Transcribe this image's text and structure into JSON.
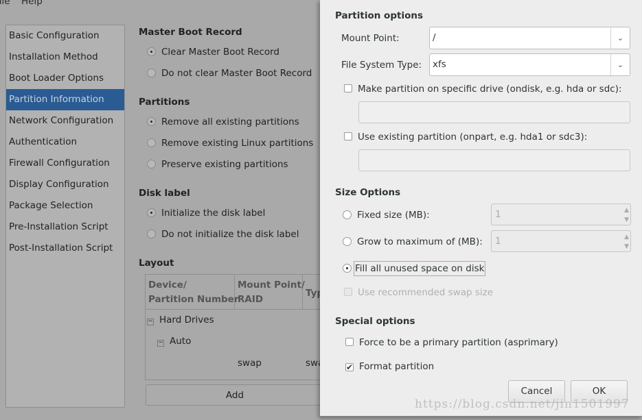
{
  "menu": {
    "file": "File",
    "help": "Help"
  },
  "sidebar": {
    "items": [
      {
        "label": "Basic Configuration"
      },
      {
        "label": "Installation Method"
      },
      {
        "label": "Boot Loader Options"
      },
      {
        "label": "Partition Information",
        "selected": true
      },
      {
        "label": "Network Configuration"
      },
      {
        "label": "Authentication"
      },
      {
        "label": "Firewall Configuration"
      },
      {
        "label": "Display Configuration"
      },
      {
        "label": "Package Selection"
      },
      {
        "label": "Pre-Installation Script"
      },
      {
        "label": "Post-Installation Script"
      }
    ]
  },
  "main": {
    "mbr": {
      "title": "Master Boot Record",
      "options": [
        {
          "label": "Clear Master Boot Record",
          "checked": true
        },
        {
          "label": "Do not clear Master Boot Record",
          "checked": false
        }
      ]
    },
    "partitions": {
      "title": "Partitions",
      "options": [
        {
          "label": "Remove all existing partitions",
          "checked": true
        },
        {
          "label": "Remove existing Linux partitions",
          "checked": false
        },
        {
          "label": "Preserve existing partitions",
          "checked": false
        }
      ]
    },
    "disk_label": {
      "title": "Disk label",
      "options": [
        {
          "label": "Initialize the disk label",
          "checked": true
        },
        {
          "label": "Do not initialize the disk label",
          "checked": false
        }
      ]
    },
    "layout": {
      "title": "Layout",
      "columns": [
        "Device/\nPartition Number",
        "Mount Point/\nRAID",
        "Type"
      ],
      "rows": [
        {
          "device": "Hard Drives"
        },
        {
          "device": "Auto"
        },
        {
          "mount": "swap",
          "type": "swap"
        }
      ],
      "add_label": "Add"
    }
  },
  "dialog": {
    "partition_options": {
      "title": "Partition options",
      "mount_point_label": "Mount Point:",
      "mount_point_value": "/",
      "fs_type_label": "File System Type:",
      "fs_type_value": "xfs",
      "ondisk_label": "Make partition on specific drive (ondisk, e.g. hda or sdc):",
      "ondisk_value": "",
      "onpart_label": "Use existing partition (onpart, e.g. hda1 or sdc3):",
      "onpart_value": ""
    },
    "size_options": {
      "title": "Size Options",
      "fixed_label": "Fixed size (MB):",
      "fixed_value": "1",
      "grow_label": "Grow to maximum of (MB):",
      "grow_value": "1",
      "fill_label": "Fill all unused space on disk",
      "selected": "fill",
      "swap_label": "Use recommended swap size"
    },
    "special_options": {
      "title": "Special options",
      "primary_label": "Force to be a primary partition (asprimary)",
      "primary_checked": false,
      "format_label": "Format partition",
      "format_checked": true
    },
    "cancel_label": "Cancel",
    "ok_label": "OK"
  },
  "watermark": "https://blog.csdn.net/jin1501997"
}
